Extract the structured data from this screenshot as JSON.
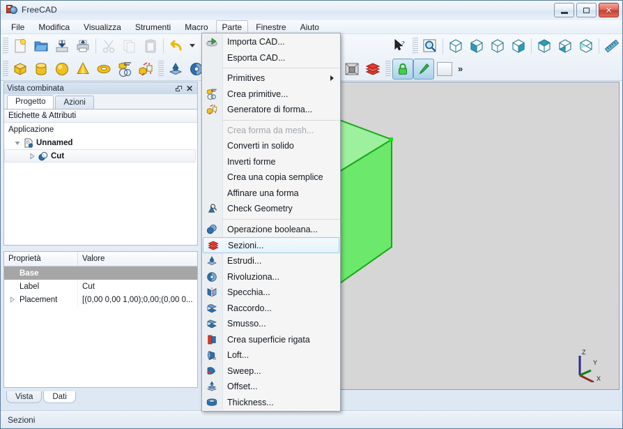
{
  "window": {
    "title": "FreeCAD",
    "minimize_label": "Minimize",
    "maximize_label": "Maximize",
    "close_label": "Close"
  },
  "menubar": {
    "items": [
      {
        "label": "File",
        "active": false
      },
      {
        "label": "Modifica",
        "active": false
      },
      {
        "label": "Visualizza",
        "active": false
      },
      {
        "label": "Strumenti",
        "active": false
      },
      {
        "label": "Macro",
        "active": false
      },
      {
        "label": "Parte",
        "active": true
      },
      {
        "label": "Finestre",
        "active": false
      },
      {
        "label": "Aiuto",
        "active": false
      }
    ]
  },
  "toolbars": {
    "row1": [
      {
        "icon": "new-document-icon",
        "disabled": false
      },
      {
        "icon": "open-folder-icon",
        "disabled": false
      },
      {
        "icon": "save-icon",
        "disabled": false
      },
      {
        "icon": "print-icon",
        "disabled": false
      },
      {
        "icon": "cut-scissors-icon",
        "disabled": true
      },
      {
        "icon": "copy-icon",
        "disabled": true
      },
      {
        "icon": "paste-icon",
        "disabled": true
      },
      {
        "icon": "undo-arrow-icon",
        "disabled": false
      },
      {
        "icon": "whats-this-cursor-icon",
        "disabled": false
      },
      {
        "icon": "fit-all-magnifier-icon",
        "disabled": false
      },
      {
        "icon": "view-axonometric-icon",
        "disabled": false
      },
      {
        "icon": "view-front-icon",
        "disabled": false
      },
      {
        "icon": "view-top-icon",
        "disabled": false
      },
      {
        "icon": "view-right-icon",
        "disabled": false
      },
      {
        "icon": "view-rear-icon",
        "disabled": false
      },
      {
        "icon": "view-bottom-icon",
        "disabled": false
      },
      {
        "icon": "view-left-icon",
        "disabled": false
      },
      {
        "icon": "measure-ruler-icon",
        "disabled": false
      }
    ],
    "row2": [
      {
        "icon": "primitive-box-icon",
        "disabled": false
      },
      {
        "icon": "primitive-cylinder-icon",
        "disabled": false
      },
      {
        "icon": "primitive-sphere-icon",
        "disabled": false
      },
      {
        "icon": "primitive-cone-icon",
        "disabled": false
      },
      {
        "icon": "primitive-torus-icon",
        "disabled": false
      },
      {
        "icon": "create-primitives-icon",
        "disabled": false
      },
      {
        "icon": "shape-builder-icon",
        "disabled": false
      },
      {
        "icon": "extrude-icon",
        "disabled": false
      },
      {
        "icon": "revolve-icon",
        "disabled": false
      },
      {
        "icon": "cross-sections-icon",
        "disabled": false
      },
      {
        "icon": "mirror-icon",
        "disabled": false
      },
      {
        "icon": "boolean-icon",
        "disabled": false
      },
      {
        "icon": "cut-boolean-icon",
        "disabled": false
      },
      {
        "icon": "union-boolean-icon",
        "disabled": false
      },
      {
        "icon": "common-boolean-icon",
        "disabled": false
      },
      {
        "icon": "check-geometry-icon",
        "disabled": false
      },
      {
        "icon": "bounding-box-icon",
        "disabled": false
      },
      {
        "icon": "sections-stack-icon",
        "disabled": false
      },
      {
        "icon": "lock-green-icon",
        "disabled": false,
        "toggled": true
      },
      {
        "icon": "pen-draw-style-icon",
        "disabled": false,
        "toggled": true
      },
      {
        "icon": "blank-square-icon",
        "disabled": false,
        "toggled": false
      }
    ],
    "overflow_label": "»"
  },
  "left_panel": {
    "dock_title": "Vista combinata",
    "tabs": [
      {
        "label": "Progetto",
        "selected": true
      },
      {
        "label": "Azioni",
        "selected": false
      }
    ],
    "tree": {
      "header": "Etichette & Attributi",
      "root": "Applicazione",
      "document": "Unnamed",
      "child": "Cut"
    },
    "properties": {
      "col_property": "Proprietà",
      "col_value": "Valore",
      "group": "Base",
      "rows": [
        {
          "name": "Label",
          "value": "Cut",
          "expandable": false
        },
        {
          "name": "Placement",
          "value": "[(0,00 0,00 1,00);0,00;(0,00 0...",
          "expandable": true
        }
      ]
    },
    "bottom_tabs": [
      {
        "label": "Vista",
        "selected": false
      },
      {
        "label": "Dati",
        "selected": true
      }
    ]
  },
  "viewport": {
    "background_color": "#d6d6d6",
    "model_color": "#8cf08c",
    "model_edge_color": "#11a311",
    "axis": {
      "z_label": "Z",
      "y_label": "Y",
      "x_label": "X",
      "z_color": "#2b2b8f",
      "y_color": "#117a11",
      "x_color": "#8f2b2b"
    }
  },
  "statusbar": {
    "message": "Sezioni"
  },
  "dropdown": {
    "owner": "Parte",
    "items": [
      {
        "label": "Importa CAD...",
        "icon": "import-cad-icon",
        "disabled": false,
        "submenu": false,
        "highlighted": false,
        "sep_after": false
      },
      {
        "label": "Esporta CAD...",
        "icon": "",
        "disabled": false,
        "submenu": false,
        "highlighted": false,
        "sep_after": true
      },
      {
        "label": "Primitives",
        "icon": "",
        "disabled": false,
        "submenu": true,
        "highlighted": false,
        "sep_after": false
      },
      {
        "label": "Crea primitive...",
        "icon": "create-primitives-icon",
        "disabled": false,
        "submenu": false,
        "highlighted": false,
        "sep_after": false
      },
      {
        "label": "Generatore di forma...",
        "icon": "shape-builder-icon",
        "disabled": false,
        "submenu": false,
        "highlighted": false,
        "sep_after": true
      },
      {
        "label": "Crea forma da mesh...",
        "icon": "",
        "disabled": true,
        "submenu": false,
        "highlighted": false,
        "sep_after": false
      },
      {
        "label": "Converti in solido",
        "icon": "",
        "disabled": false,
        "submenu": false,
        "highlighted": false,
        "sep_after": false
      },
      {
        "label": "Inverti forme",
        "icon": "",
        "disabled": false,
        "submenu": false,
        "highlighted": false,
        "sep_after": false
      },
      {
        "label": "Crea una copia semplice",
        "icon": "",
        "disabled": false,
        "submenu": false,
        "highlighted": false,
        "sep_after": false
      },
      {
        "label": "Affinare una forma",
        "icon": "",
        "disabled": false,
        "submenu": false,
        "highlighted": false,
        "sep_after": false
      },
      {
        "label": "Check Geometry",
        "icon": "check-geometry-icon",
        "disabled": false,
        "submenu": false,
        "highlighted": false,
        "sep_after": true
      },
      {
        "label": "Operazione booleana...",
        "icon": "boolean-icon",
        "disabled": false,
        "submenu": false,
        "highlighted": false,
        "sep_after": false
      },
      {
        "label": "Sezioni...",
        "icon": "cross-sections-icon",
        "disabled": false,
        "submenu": false,
        "highlighted": true,
        "sep_after": false
      },
      {
        "label": "Estrudi...",
        "icon": "extrude-icon",
        "disabled": false,
        "submenu": false,
        "highlighted": false,
        "sep_after": false
      },
      {
        "label": "Rivoluziona...",
        "icon": "revolve-icon",
        "disabled": false,
        "submenu": false,
        "highlighted": false,
        "sep_after": false
      },
      {
        "label": "Specchia...",
        "icon": "mirror-icon",
        "disabled": false,
        "submenu": false,
        "highlighted": false,
        "sep_after": false
      },
      {
        "label": "Raccordo...",
        "icon": "fillet-icon",
        "disabled": false,
        "submenu": false,
        "highlighted": false,
        "sep_after": false
      },
      {
        "label": "Smusso...",
        "icon": "chamfer-icon",
        "disabled": false,
        "submenu": false,
        "highlighted": false,
        "sep_after": false
      },
      {
        "label": "Crea superficie rigata",
        "icon": "ruled-surface-icon",
        "disabled": false,
        "submenu": false,
        "highlighted": false,
        "sep_after": false
      },
      {
        "label": "Loft...",
        "icon": "loft-icon",
        "disabled": false,
        "submenu": false,
        "highlighted": false,
        "sep_after": false
      },
      {
        "label": "Sweep...",
        "icon": "sweep-icon",
        "disabled": false,
        "submenu": false,
        "highlighted": false,
        "sep_after": false
      },
      {
        "label": "Offset...",
        "icon": "offset-icon",
        "disabled": false,
        "submenu": false,
        "highlighted": false,
        "sep_after": false
      },
      {
        "label": "Thickness...",
        "icon": "thickness-icon",
        "disabled": false,
        "submenu": false,
        "highlighted": false,
        "sep_after": false
      }
    ]
  }
}
